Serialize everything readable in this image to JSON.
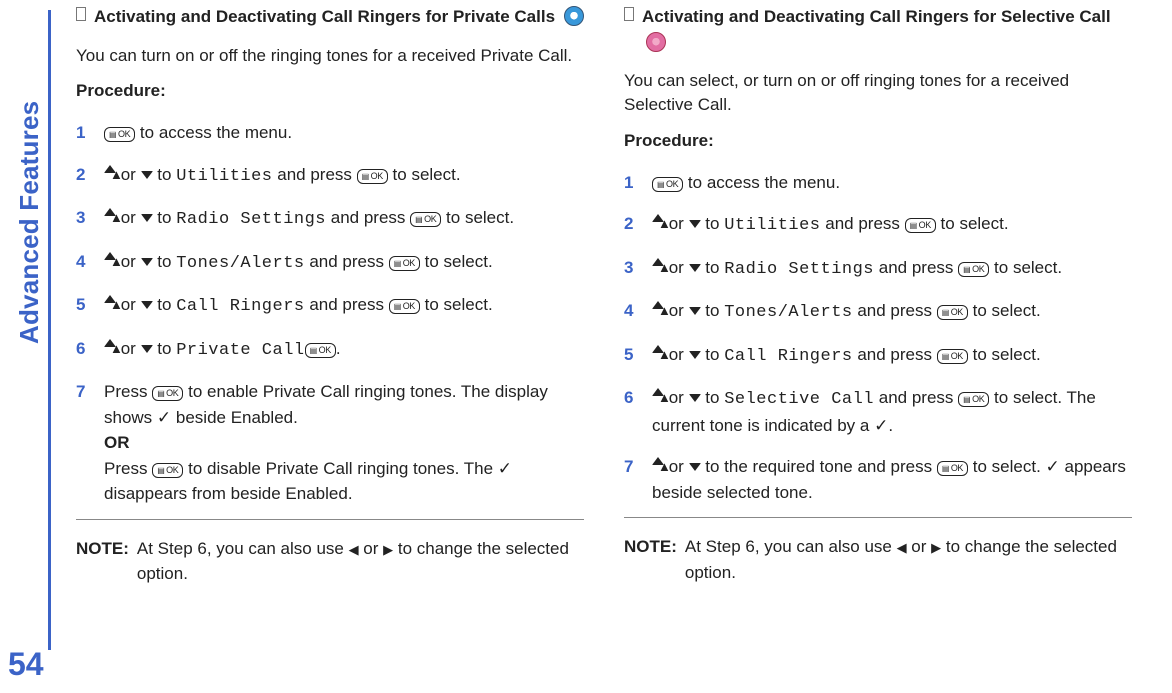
{
  "page_number": "54",
  "section_label": "Advanced Features",
  "left": {
    "title": "Activating and Deactivating Call Ringers for Private Calls",
    "intro": "You can turn on or off the ringing tones for a received Private Call.",
    "procedure_label": "Procedure:",
    "steps": {
      "s1_a": " to access the menu.",
      "s2_a": " or ",
      "s2_b": " to ",
      "s2_menu": "Utilities",
      "s2_c": " and press ",
      "s2_d": " to select.",
      "s3_menu": "Radio Settings",
      "s4_menu": "Tones/Alerts",
      "s5_menu": "Call Ringers",
      "s6_a": " or ",
      "s6_b": " to ",
      "s6_menu": "Private Call",
      "s6_c": ".",
      "s7_a": "Press ",
      "s7_b": " to enable Private Call ringing tones. The display shows ",
      "s7_c": " beside Enabled.",
      "s7_or": "OR",
      "s7_d": "Press ",
      "s7_e": " to disable Private Call ringing tones. The ",
      "s7_f": " disappears from beside Enabled."
    },
    "note_label": "NOTE:",
    "note_a": "At Step 6, you can also use ",
    "note_b": " or ",
    "note_c": " to change the selected option."
  },
  "right": {
    "title": "Activating and Deactivating Call Ringers for Selective Call",
    "intro": "You can select, or turn on or off ringing tones for a received Selective Call.",
    "procedure_label": "Procedure:",
    "steps": {
      "s1_a": " to access the menu.",
      "s2_menu": "Utilities",
      "s3_menu": "Radio Settings",
      "s4_menu": "Tones/Alerts",
      "s5_menu": "Call Ringers",
      "s6_a": " or ",
      "s6_b": " to ",
      "s6_menu": "Selective Call",
      "s6_c": " and press ",
      "s6_d": " to select. The current tone is indicated by a ",
      "s6_e": ".",
      "s7_a": " or ",
      "s7_b": " to the required tone and press ",
      "s7_c": " to select. ",
      "s7_d": " appears beside selected tone."
    },
    "note_label": "NOTE:",
    "note_a": "At Step 6, you can also use ",
    "note_b": " or ",
    "note_c": " to change the selected option."
  },
  "common": {
    "and_press": " and press ",
    "to_select": " to select.",
    "or": " or ",
    "to": " to "
  }
}
